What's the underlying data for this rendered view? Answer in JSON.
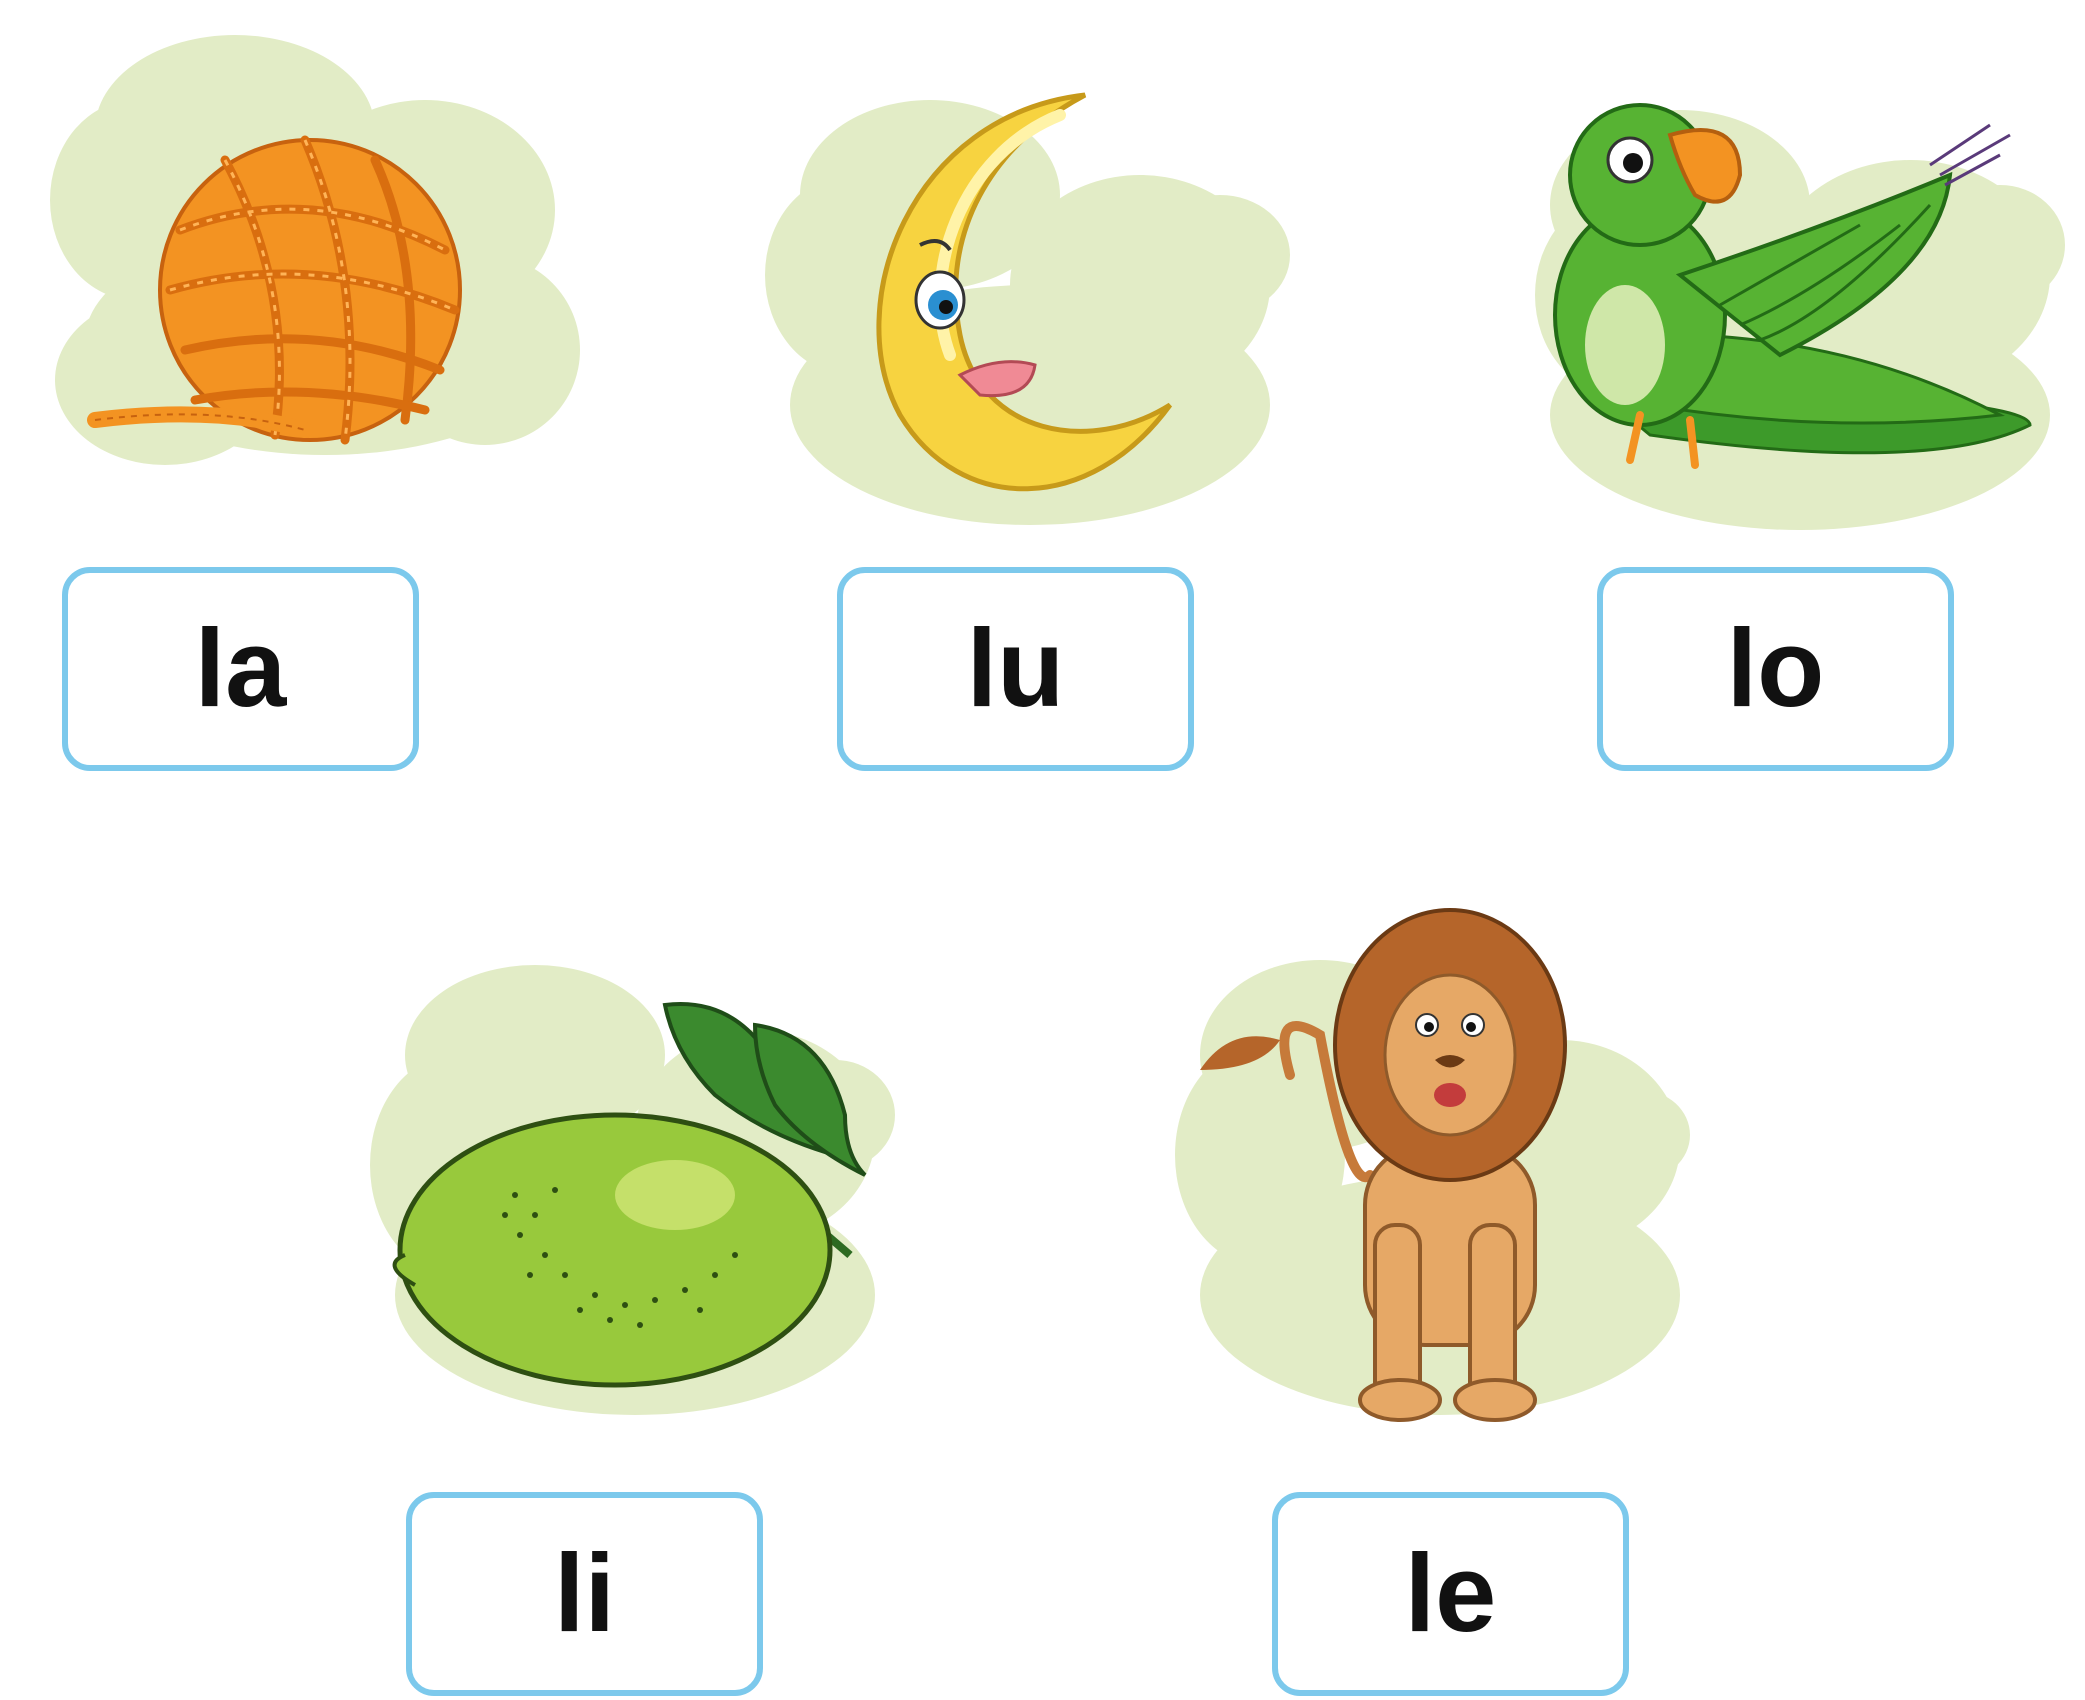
{
  "colors": {
    "cloud": "#e2ecc6",
    "box_border": "#7cc9ec",
    "label_text": "#111111",
    "yarn": "#f39322",
    "moon": "#f7d340",
    "parrot": "#57b333",
    "lime": "#98c93c",
    "lion": "#e6a866"
  },
  "cards": [
    {
      "icon": "yarn-ball-icon",
      "syllable": "la"
    },
    {
      "icon": "crescent-moon-icon",
      "syllable": "lu"
    },
    {
      "icon": "parrot-icon",
      "syllable": "lo"
    },
    {
      "icon": "lime-icon",
      "syllable": "li"
    },
    {
      "icon": "lion-icon",
      "syllable": "le"
    }
  ]
}
